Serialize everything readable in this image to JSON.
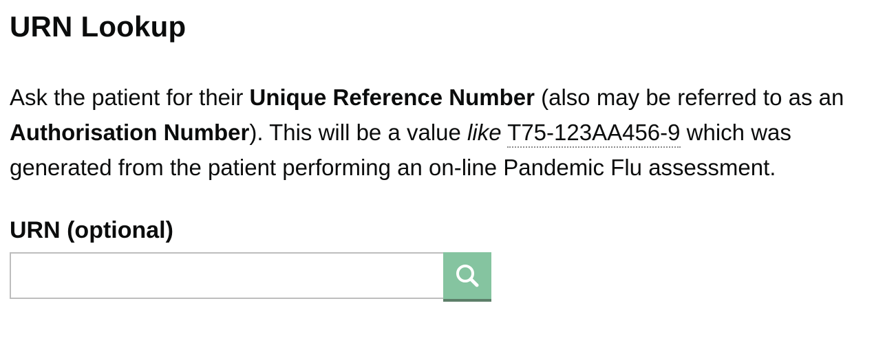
{
  "page": {
    "title": "URN Lookup"
  },
  "intro": {
    "part1": "Ask the patient for their ",
    "strong1": "Unique Reference Number",
    "part2": " (also may be referred to as an ",
    "strong2": "Authorisation Number",
    "part3": "). This will be a value ",
    "like_word": "like",
    "space": " ",
    "example_urn": "T75-123AA456-9",
    "part4": " which was generated from the patient performing an on-line Pandemic Flu assessment."
  },
  "form": {
    "urn_label": "URN (optional)",
    "urn_value": "",
    "search_icon": "search-icon"
  },
  "colors": {
    "search_button": "#85c4a0",
    "search_button_shadow": "#5c7f69",
    "text": "#0b0c0c"
  }
}
